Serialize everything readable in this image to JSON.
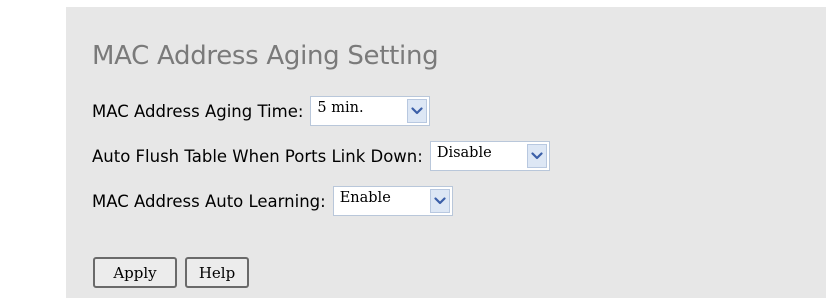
{
  "page": {
    "title": "MAC Address Aging Setting"
  },
  "form": {
    "aging_time": {
      "label": "MAC Address Aging Time:",
      "value": "5 min."
    },
    "auto_flush": {
      "label": "Auto Flush Table When Ports Link Down:",
      "value": "Disable"
    },
    "auto_learning": {
      "label": "MAC Address Auto Learning:",
      "value": "Enable"
    }
  },
  "buttons": {
    "apply_label": "Apply",
    "help_label": "Help"
  },
  "icons": {
    "dropdown": "chevron-down-icon"
  },
  "colors": {
    "panel_bg": "#e7e7e7",
    "title_text": "#7a7a7a",
    "arrow_bg": "#dde7f5",
    "arrow_glyph": "#3b5fa8"
  }
}
